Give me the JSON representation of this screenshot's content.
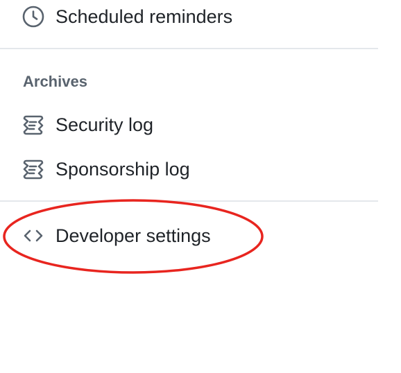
{
  "nav": {
    "top_item": {
      "label": "Scheduled reminders",
      "icon": "clock-icon"
    },
    "archives": {
      "heading": "Archives",
      "items": [
        {
          "label": "Security log",
          "icon": "log-icon"
        },
        {
          "label": "Sponsorship log",
          "icon": "log-icon"
        }
      ]
    },
    "developer": {
      "label": "Developer settings",
      "icon": "code-icon"
    }
  },
  "annotation": {
    "color": "#e8251f"
  },
  "colors": {
    "text": "#1f2328",
    "muted": "#59636e",
    "divider": "#e4e7eb"
  }
}
